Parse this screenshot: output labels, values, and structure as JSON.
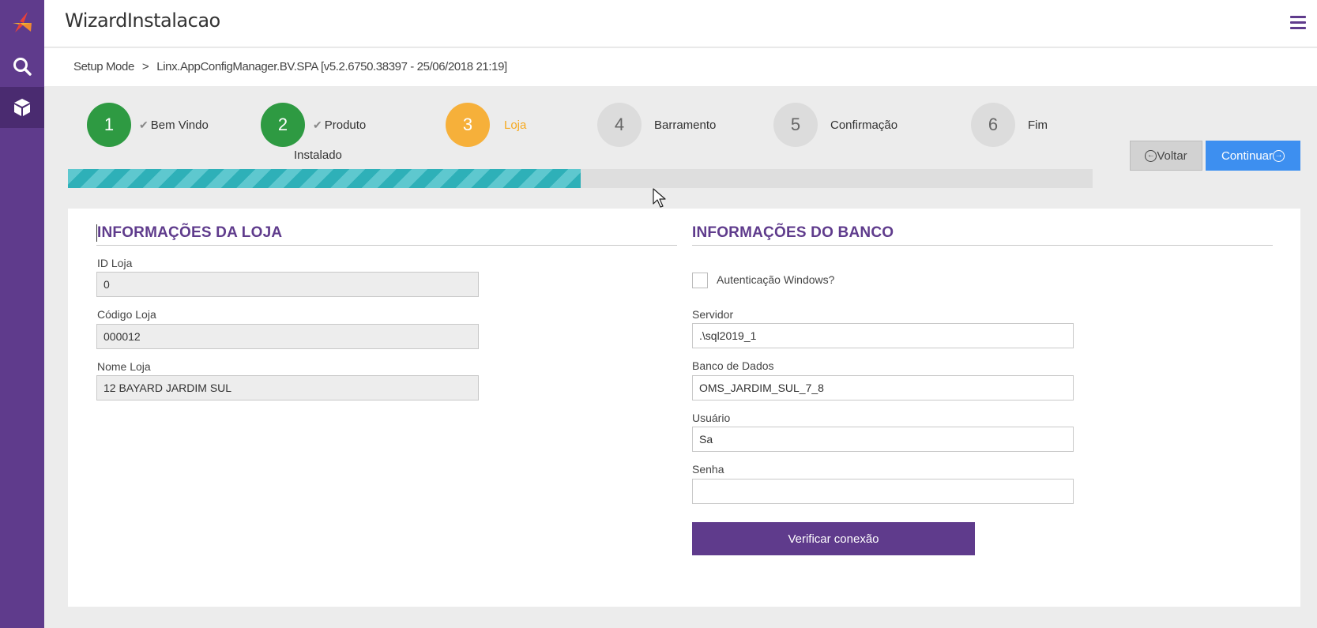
{
  "app": {
    "title": "WizardInstalacao"
  },
  "sidebar": {
    "items": [
      {
        "name": "logo",
        "icon": "linx-logo-icon"
      },
      {
        "name": "search",
        "icon": "search-icon"
      },
      {
        "name": "packages",
        "icon": "box-icon"
      }
    ]
  },
  "breadcrumb": {
    "root": "Setup Mode",
    "separator": ">",
    "current": "Linx.AppConfigManager.BV.SPA [v5.2.6750.38397 - 25/06/2018 21:19]"
  },
  "wizard": {
    "steps": [
      {
        "number": "1",
        "label": "Bem Vindo",
        "sublabel": "",
        "status": "done"
      },
      {
        "number": "2",
        "label": "Produto",
        "sublabel": "Instalado",
        "status": "done"
      },
      {
        "number": "3",
        "label": "Loja",
        "sublabel": "",
        "status": "current"
      },
      {
        "number": "4",
        "label": "Barramento",
        "sublabel": "",
        "status": "todo"
      },
      {
        "number": "5",
        "label": "Confirmação",
        "sublabel": "",
        "status": "todo"
      },
      {
        "number": "6",
        "label": "Fim",
        "sublabel": "",
        "status": "todo"
      }
    ],
    "progress_percent": 50,
    "back_label": "Voltar",
    "next_label": "Continuar"
  },
  "store": {
    "title": "INFORMAÇÕES DA LOJA",
    "id": {
      "label": "ID Loja",
      "value": "0"
    },
    "code": {
      "label": "Código Loja",
      "value": "000012"
    },
    "name": {
      "label": "Nome Loja",
      "value": "12 BAYARD JARDIM SUL"
    }
  },
  "database": {
    "title": "INFORMAÇÕES DO BANCO",
    "windows_auth": {
      "label": "Autenticação Windows?",
      "checked": false
    },
    "server": {
      "label": "Servidor",
      "value": ".\\sql2019_1"
    },
    "db_name": {
      "label": "Banco de Dados",
      "value": "OMS_JARDIM_SUL_7_8"
    },
    "user": {
      "label": "Usuário",
      "value": "Sa"
    },
    "password": {
      "label": "Senha",
      "value": ""
    },
    "verify_label": "Verificar conexão"
  },
  "colors": {
    "brand": "#5f3b8c",
    "step_done": "#2e9a42",
    "step_current": "#f6b03a",
    "progress": "#2eb0b8",
    "primary_button": "#3d8ff0"
  }
}
